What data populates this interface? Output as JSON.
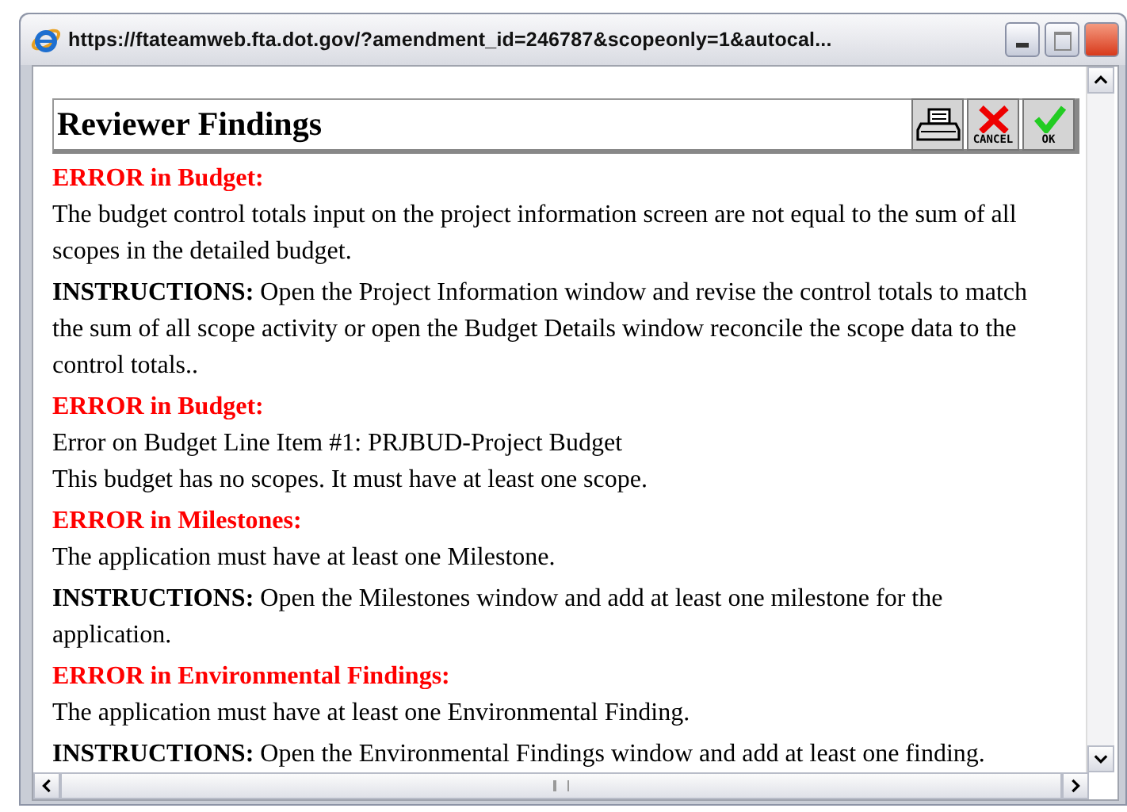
{
  "window": {
    "title": "https://ftateamweb.fta.dot.gov/?amendment_id=246787&scopeonly=1&autocal..."
  },
  "header": {
    "title": "Reviewer Findings",
    "buttons": [
      {
        "kind": "print"
      },
      {
        "kind": "cancel",
        "label": "CANCEL"
      },
      {
        "kind": "ok",
        "label": "OK"
      }
    ]
  },
  "findings": [
    {
      "kind": "error",
      "text": "ERROR in Budget:"
    },
    {
      "kind": "text",
      "text": "The budget control totals input on the project information screen are not equal to the sum of all scopes in the detailed budget."
    },
    {
      "kind": "instructions",
      "text": "**INSTRUCTIONS:** Open the Project Information window and revise the control totals to match the sum of all scope activity or open the Budget Details window reconcile the scope data to the control totals.."
    },
    {
      "kind": "error",
      "text": "ERROR in Budget:"
    },
    {
      "kind": "line",
      "text": "Error on Budget Line Item #1: PRJBUD-Project Budget"
    },
    {
      "kind": "text",
      "text": "This budget has no scopes. It must have at least one scope."
    },
    {
      "kind": "error",
      "text": "ERROR in Milestones:"
    },
    {
      "kind": "text",
      "text": "The application must have at least one Milestone."
    },
    {
      "kind": "instructions",
      "text": "**INSTRUCTIONS:** Open the Milestones window and add at least one milestone for the application."
    },
    {
      "kind": "error",
      "text": "ERROR in Environmental Findings:"
    },
    {
      "kind": "text",
      "text": "The application must have at least one Environmental Finding."
    },
    {
      "kind": "instructions",
      "text": "**INSTRUCTIONS:** Open the Environmental Findings window and add at least one finding."
    }
  ]
}
